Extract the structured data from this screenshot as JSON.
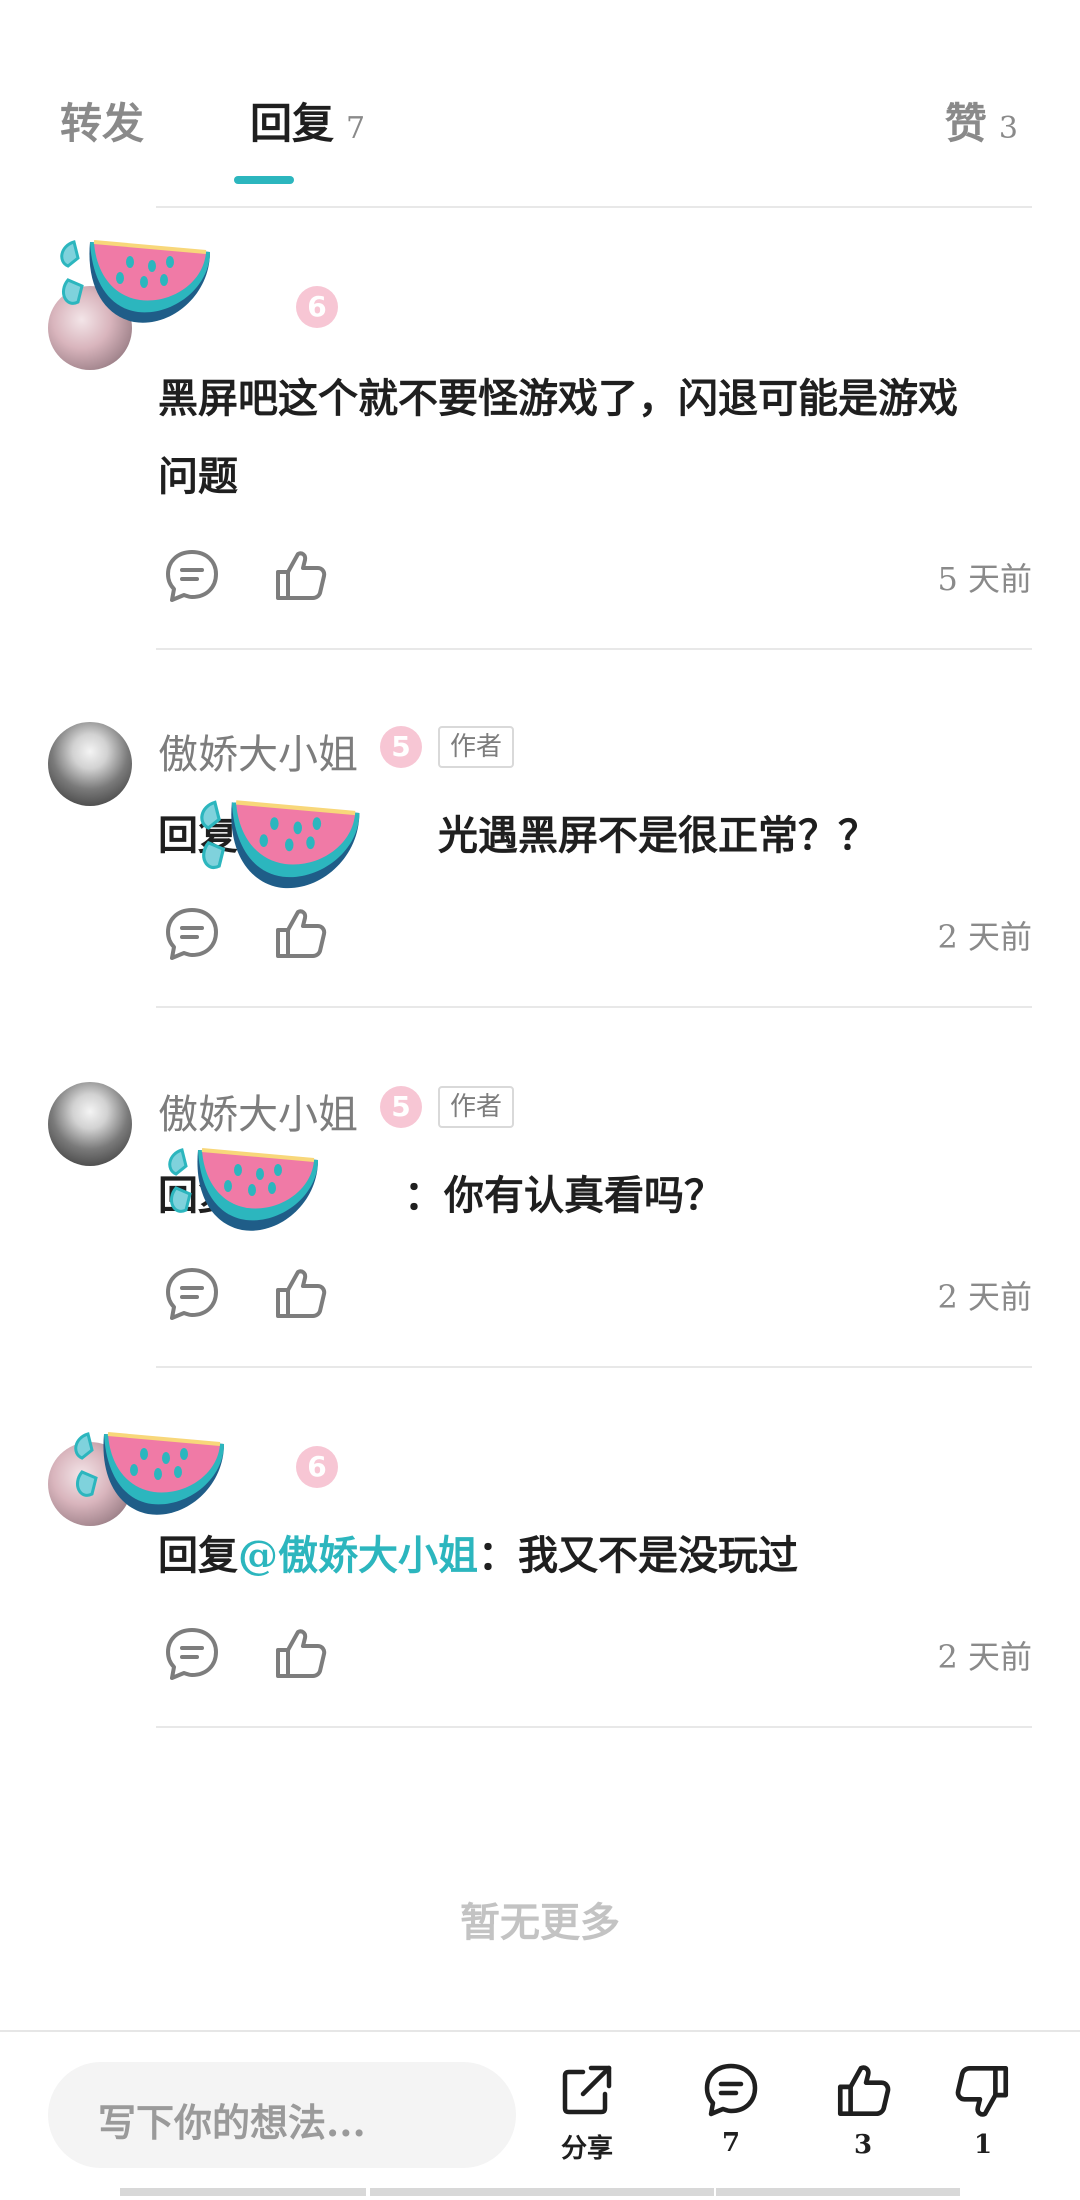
{
  "tabs": {
    "forward_label": "转发",
    "reply_label": "回复",
    "reply_count": "7",
    "like_label": "赞",
    "like_count": "3"
  },
  "comments": [
    {
      "username": "",
      "level": "6",
      "is_author": false,
      "content_lines": [
        "黑屏吧这个就不要怪游戏了，闪退可能是游戏",
        "问题"
      ],
      "time": "5 天前"
    },
    {
      "username": "傲娇大小姐",
      "level": "5",
      "is_author": true,
      "author_tag": "作者",
      "reply_prefix": "回复",
      "mention": "@",
      "text": "光遇黑屏不是很正常？？",
      "time": "2 天前"
    },
    {
      "username": "傲娇大小姐",
      "level": "5",
      "is_author": true,
      "author_tag": "作者",
      "reply_prefix": "回复",
      "text": "：你有认真看吗？",
      "time": "2 天前"
    },
    {
      "username": "",
      "level": "6",
      "is_author": false,
      "reply_prefix": "回复",
      "mention": "@傲娇大小姐",
      "text": "：我又不是没玩过",
      "time": "2 天前"
    }
  ],
  "no_more": "暂无更多",
  "bottom_bar": {
    "input_placeholder": "写下你的想法...",
    "share_label": "分享",
    "comment_count": "7",
    "like_count": "3",
    "dislike_count": "1"
  },
  "colors": {
    "accent": "#2cb6be",
    "level_badge": "#f7c6d4",
    "sticker_pink": "#f07aa6",
    "sticker_teal": "#2cb6be"
  }
}
